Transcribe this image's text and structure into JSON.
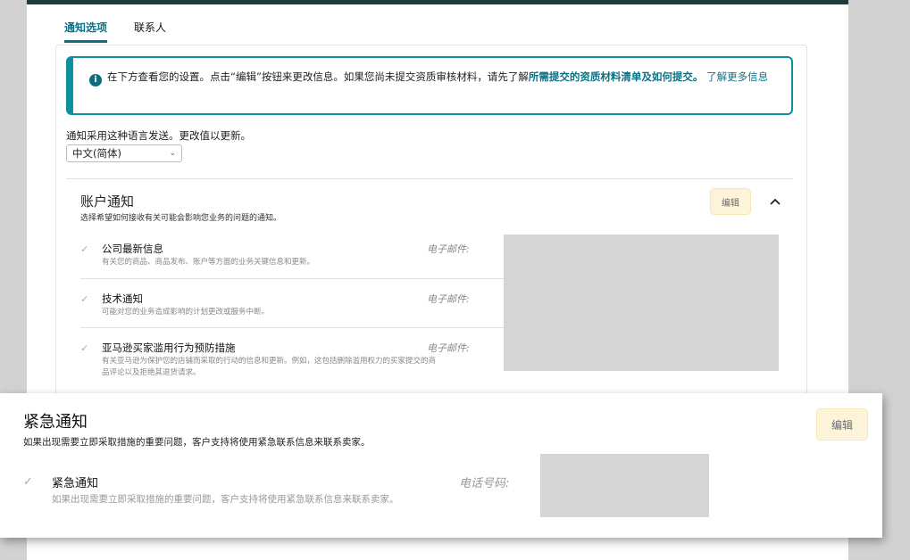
{
  "tabs": [
    {
      "label": "通知选项",
      "active": true
    },
    {
      "label": "联系人",
      "active": false
    }
  ],
  "alert": {
    "text_before": "在下方查看您的设置。点击“编辑”按钮来更改信息。如果您尚未提交资质审核材料，请先了解",
    "link_bold": "所需提交的资质材料清单及如何提交。",
    "link_more": "了解更多信息"
  },
  "language": {
    "description": "通知采用这种语言发送。更改值以更新。",
    "selected": "中文(简体)"
  },
  "account_notifications": {
    "title": "账户通知",
    "subtitle": "选择希望如何接收有关可能会影响您业务的问题的通知。",
    "edit_label": "编辑",
    "items": [
      {
        "title": "公司最新信息",
        "desc": "有关您的商品、商品发布、账户等方面的业务关键信息和更新。",
        "field_label": "电子邮件:"
      },
      {
        "title": "技术通知",
        "desc": "可能对您的业务造成影响的计划更改或服务中断。",
        "field_label": "电子邮件:"
      },
      {
        "title": "亚马逊买家滥用行为预防措施",
        "desc": "有关亚马逊为保护您的店铺而采取的行动的信息和更新。例如，这包括删除滥用权力的买家提交的商品评论以及拒绝其退货请求。",
        "field_label": "电子邮件:"
      }
    ]
  },
  "emergency_notifications": {
    "title": "紧急通知",
    "subtitle": "如果出现需要立即采取措施的重要问题，客户支持将使用紧急联系信息来联系卖家。",
    "edit_label": "编辑",
    "item": {
      "title": "紧急通知",
      "desc": "如果出现需要立即采取措施的重要问题，客户支持将使用紧急联系信息来联系卖家。",
      "field_label": "电话号码:"
    }
  },
  "colors": {
    "accent": "#0b7285",
    "edit_bg": "#fcf3d8",
    "placeholder": "#d5d5d5"
  }
}
